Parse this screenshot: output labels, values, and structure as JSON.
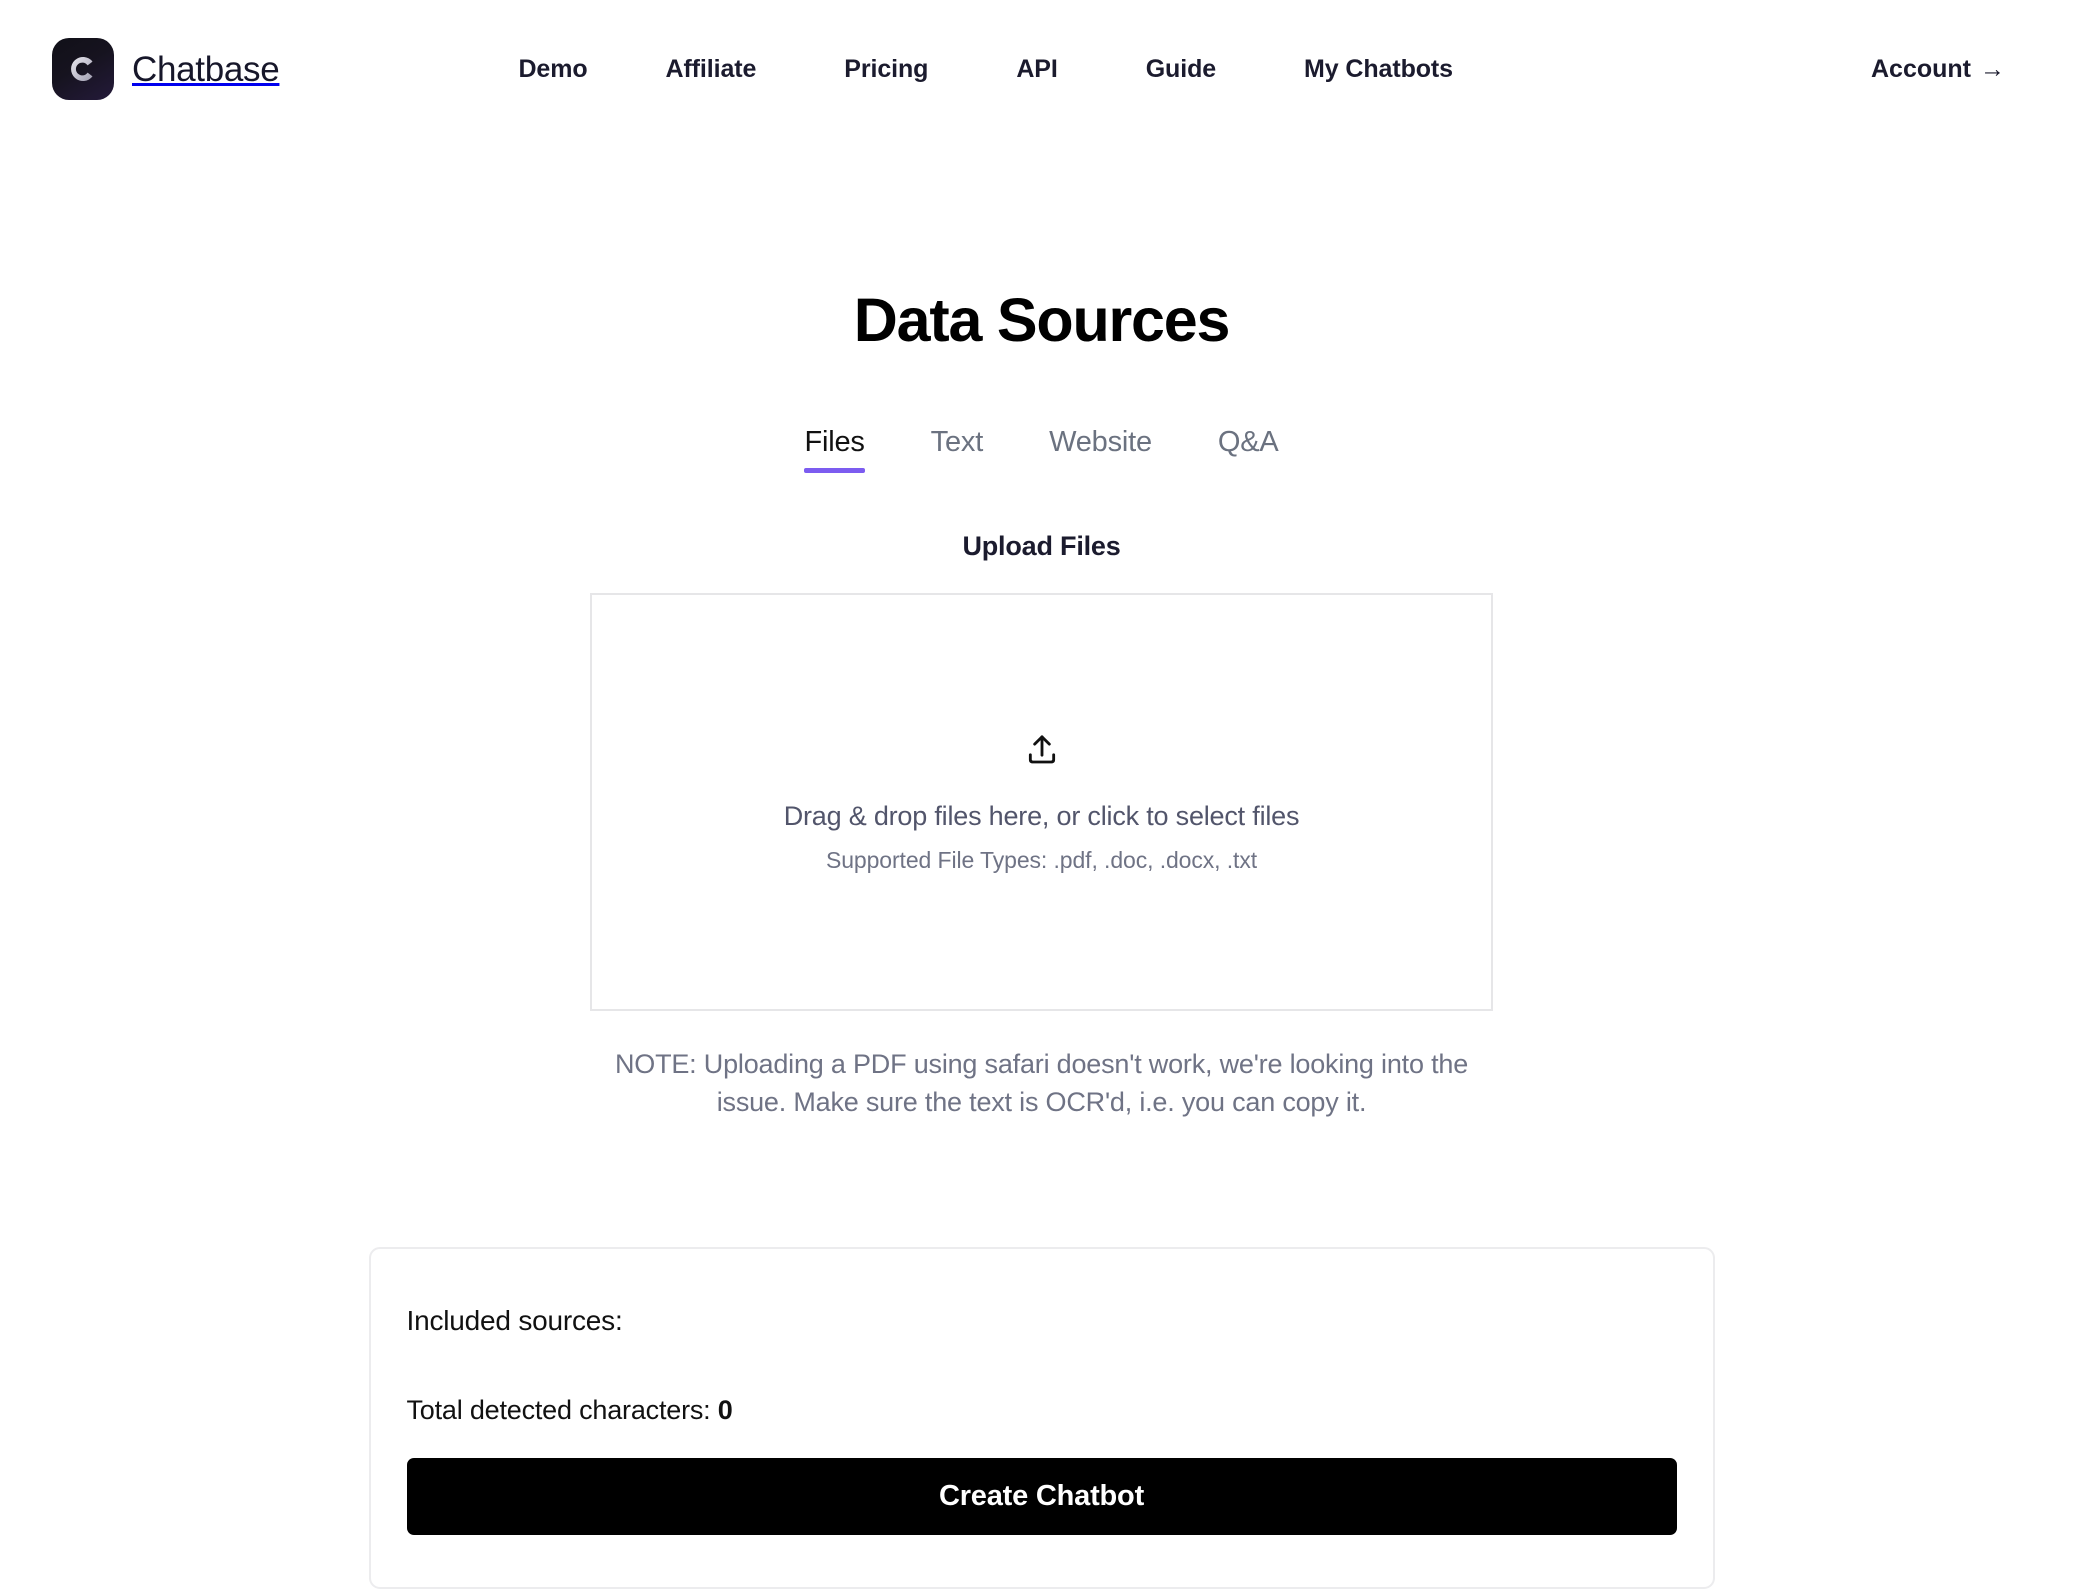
{
  "brand": {
    "name": "Chatbase",
    "logo_glyph": "C",
    "logo_bg": "#16131f",
    "logo_fg": "#c9c7d4"
  },
  "nav": {
    "items": [
      {
        "label": "Demo"
      },
      {
        "label": "Affiliate"
      },
      {
        "label": "Pricing"
      },
      {
        "label": "API"
      },
      {
        "label": "Guide"
      },
      {
        "label": "My Chatbots"
      }
    ],
    "account": {
      "label": "Account",
      "arrow": "→"
    }
  },
  "page": {
    "title": "Data Sources"
  },
  "tabs": {
    "active_index": 0,
    "accent": "#7c5cf0",
    "items": [
      {
        "label": "Files",
        "active": true
      },
      {
        "label": "Text",
        "active": false
      },
      {
        "label": "Website",
        "active": false
      },
      {
        "label": "Q&A",
        "active": false
      }
    ]
  },
  "upload": {
    "section_label": "Upload Files",
    "icon": "upload-icon",
    "dropzone_primary": "Drag & drop files here, or click to select files",
    "dropzone_secondary": "Supported File Types: .pdf, .doc, .docx, .txt",
    "note": "NOTE: Uploading a PDF using safari doesn't work, we're looking into the issue. Make sure the text is OCR'd, i.e. you can copy it."
  },
  "sources": {
    "heading": "Included sources:",
    "total_label": "Total detected characters: ",
    "total_value": "0",
    "create_button": "Create Chatbot"
  }
}
